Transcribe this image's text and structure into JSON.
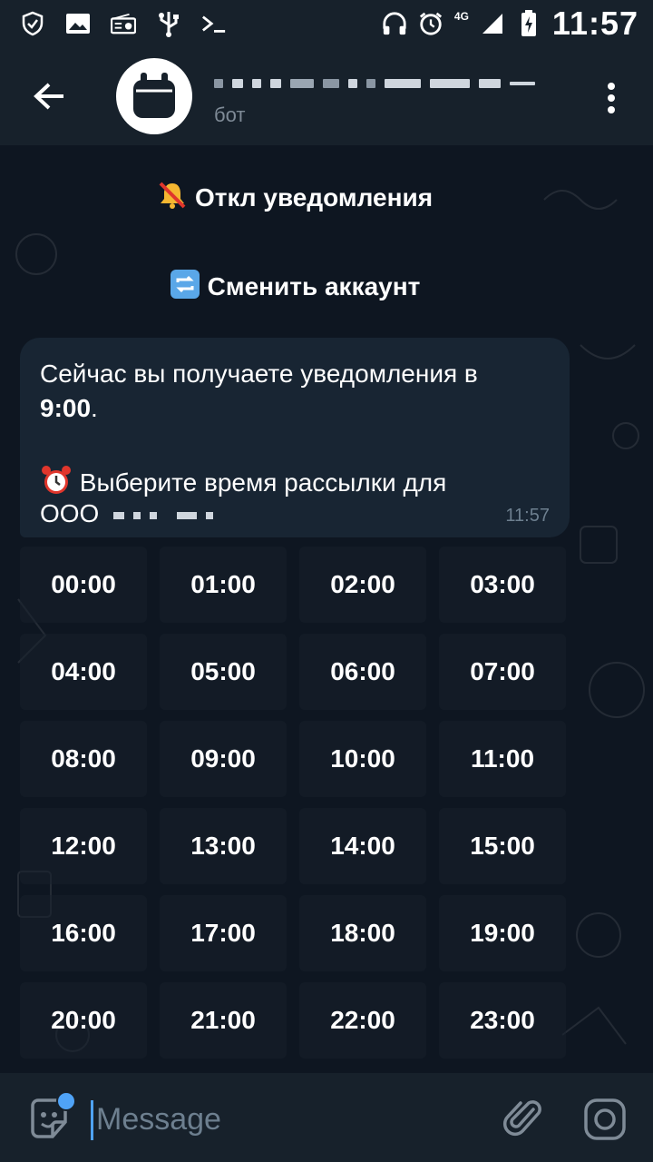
{
  "status_bar": {
    "time": "11:57",
    "network": "4G"
  },
  "header": {
    "subtitle": "бот"
  },
  "chat": {
    "button_notifications": "Откл уведомления",
    "button_switch_account": "Сменить аккаунт",
    "message": {
      "line1": "Сейчас вы получаете уведомления в",
      "line2": "9:00",
      "line2_suffix": ".",
      "line3": "Выберите время рассылки для",
      "line4_prefix": "ООО",
      "time": "11:57"
    },
    "time_options": [
      "00:00",
      "01:00",
      "02:00",
      "03:00",
      "04:00",
      "05:00",
      "06:00",
      "07:00",
      "08:00",
      "09:00",
      "10:00",
      "11:00",
      "12:00",
      "13:00",
      "14:00",
      "15:00",
      "16:00",
      "17:00",
      "18:00",
      "19:00",
      "20:00",
      "21:00",
      "22:00",
      "23:00"
    ]
  },
  "input": {
    "placeholder": "Message"
  },
  "colors": {
    "header_bg": "#17212b",
    "chat_bg": "#0e1621",
    "bubble_bg": "#182533",
    "accent": "#4fa3f7"
  }
}
